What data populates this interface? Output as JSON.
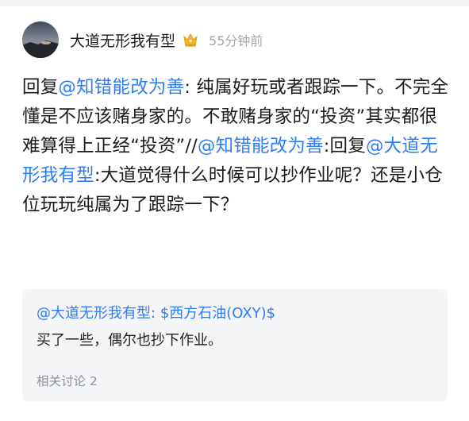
{
  "post": {
    "author": "大道无形我有型",
    "time": "55分钟前",
    "body": {
      "s1": "回复",
      "m1": "@知错能改为善",
      "s2": ": 纯属好玩或者跟踪一下。不完全懂是不应该赌身家的。不敢赌身家的“投资”其实都很难算得上正经“投资”//",
      "m2": "@知错能改为善",
      "s3": ":回复",
      "m3": "@大道无形我有型",
      "s4": ":大道觉得什么时候可以抄作业呢？还是小仓位玩玩纯属为了跟踪一下？"
    }
  },
  "quote": {
    "author": "@大道无形我有型:",
    "stock": "$西方石油(OXY)$",
    "text": "买了一些，偶尔也抄下作业。",
    "related": "相关讨论 2"
  },
  "colors": {
    "link": "#2e7cf6",
    "muted": "#a2a6ad",
    "card_bg": "#f4f5f7"
  },
  "icons": {
    "badge": "gold-crown-badge-icon"
  }
}
